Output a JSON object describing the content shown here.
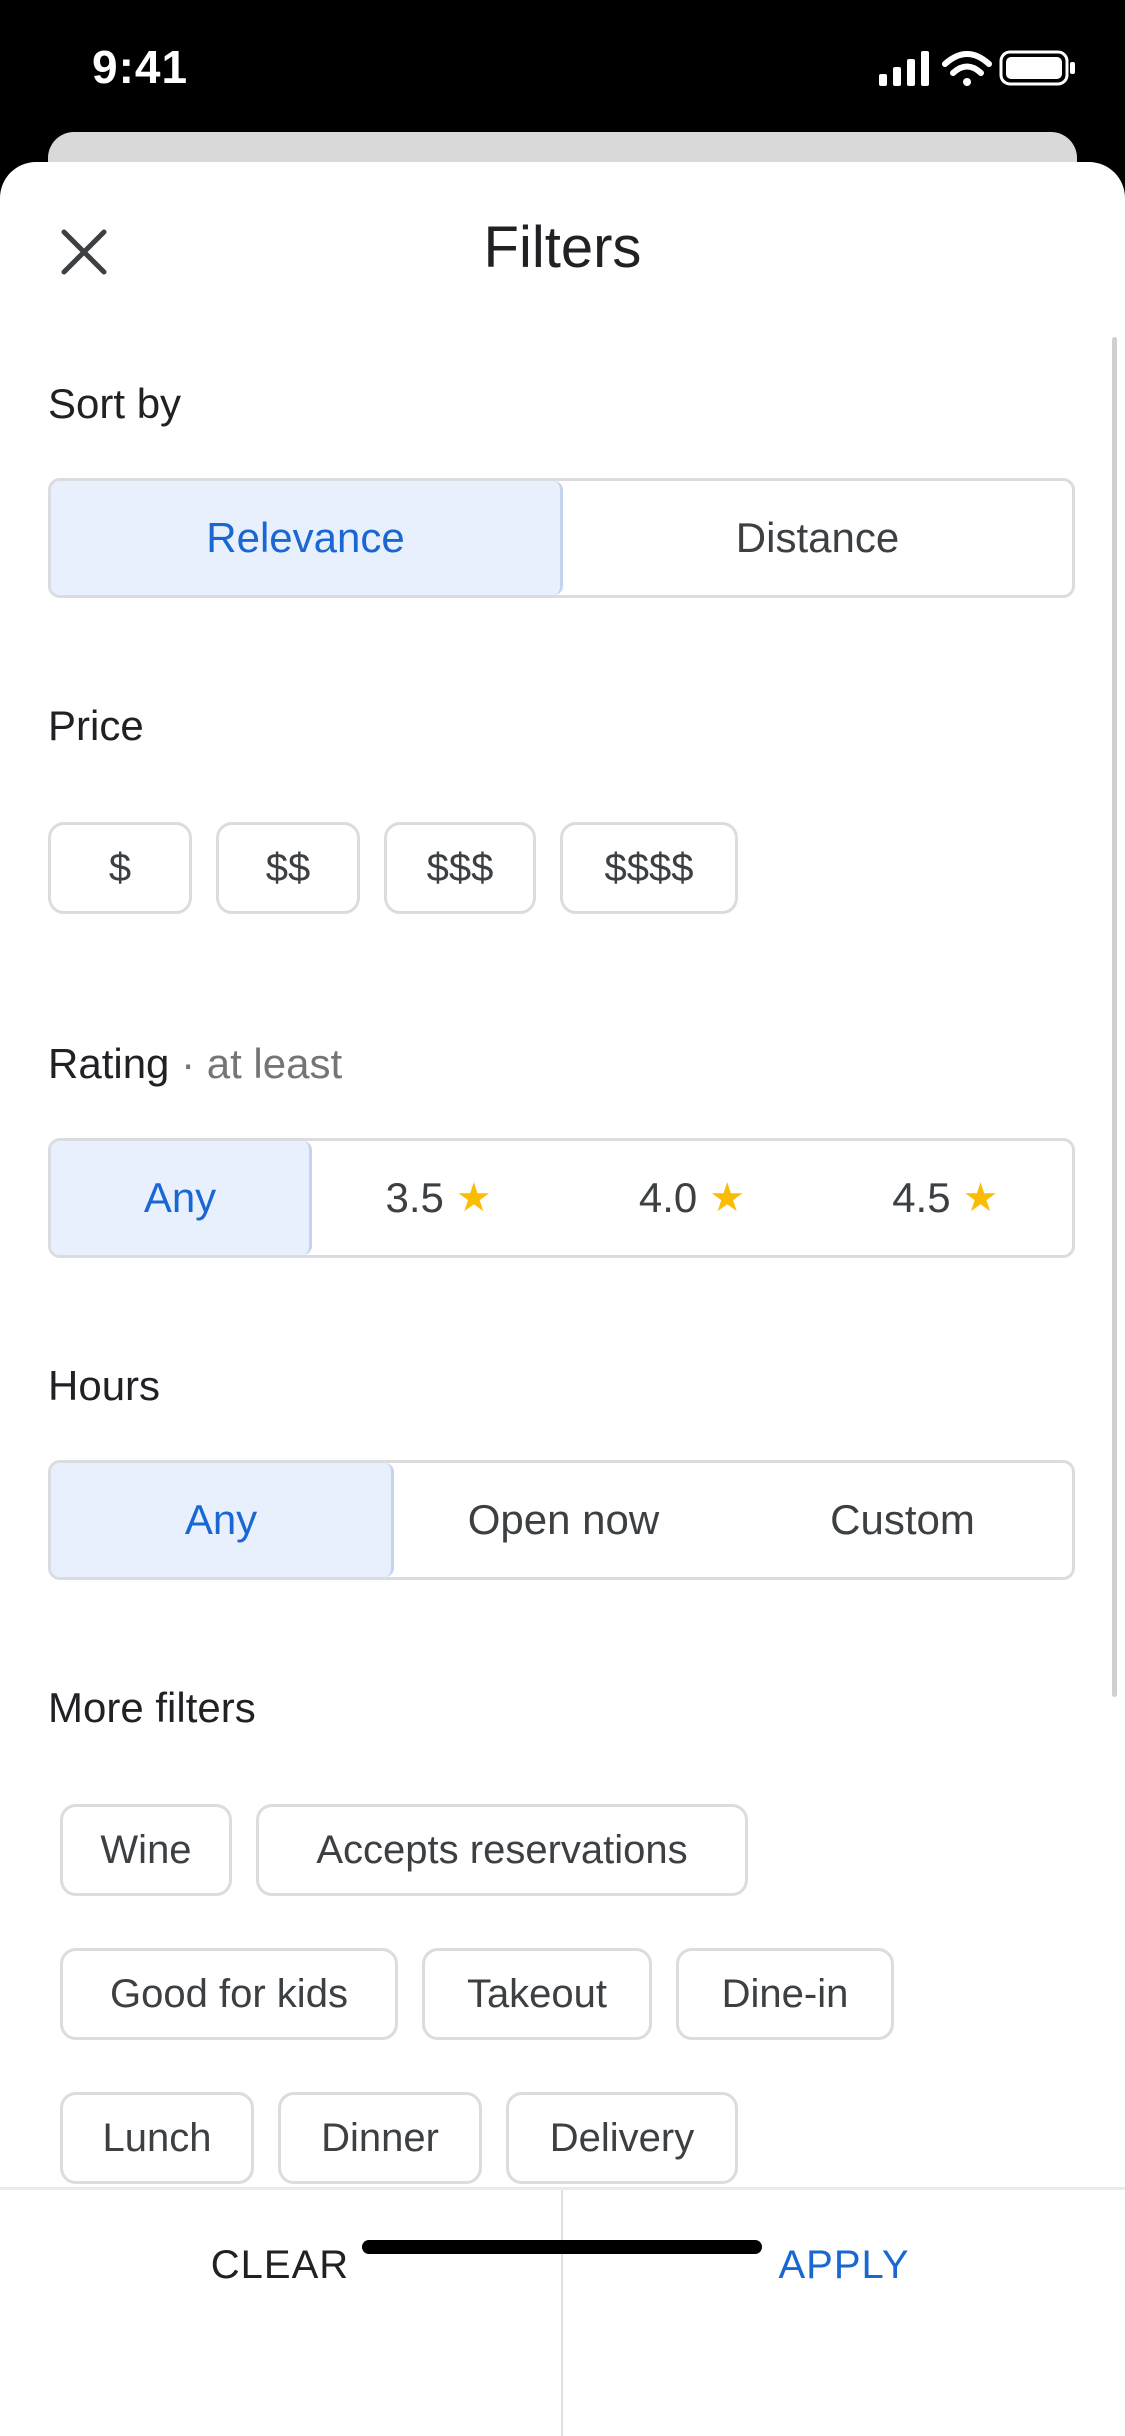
{
  "status_bar": {
    "time": "9:41"
  },
  "header": {
    "title": "Filters"
  },
  "sort": {
    "label": "Sort by",
    "options": [
      "Relevance",
      "Distance"
    ],
    "selected": "Relevance"
  },
  "price": {
    "label": "Price",
    "options": [
      "$",
      "$$",
      "$$$",
      "$$$$"
    ]
  },
  "rating": {
    "label": "Rating",
    "sublabel": "· at least",
    "options": [
      "Any",
      "3.5",
      "4.0",
      "4.5"
    ],
    "selected": "Any",
    "star_glyph": "★"
  },
  "hours": {
    "label": "Hours",
    "options": [
      "Any",
      "Open now",
      "Custom"
    ],
    "selected": "Any"
  },
  "more_filters": {
    "label": "More filters",
    "chips": [
      "Wine",
      "Accepts reservations",
      "Good for kids",
      "Takeout",
      "Dine-in",
      "Lunch",
      "Dinner",
      "Delivery"
    ]
  },
  "footer": {
    "clear_label": "CLEAR",
    "apply_label": "APPLY"
  },
  "colors": {
    "accent": "#1967d2",
    "selected_bg": "#e8f0fe",
    "star": "#fbbc04",
    "border": "#dadce0"
  }
}
